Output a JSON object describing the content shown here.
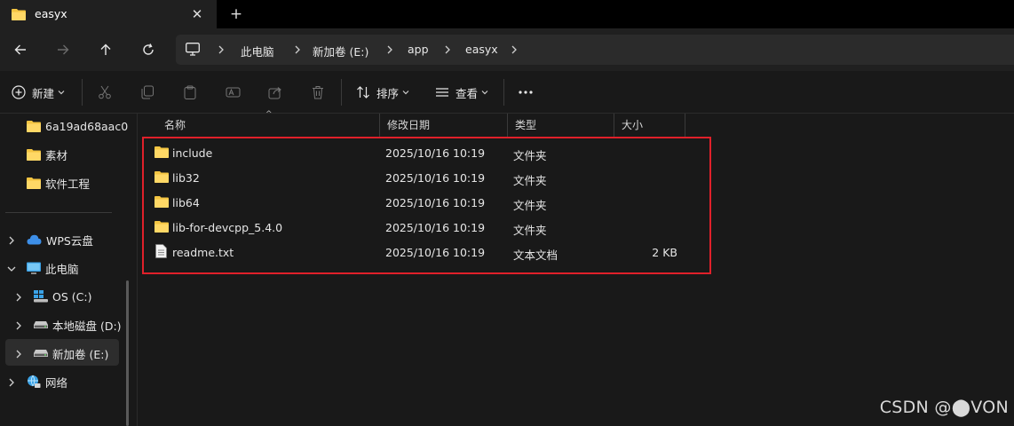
{
  "tab": {
    "title": "easyx"
  },
  "breadcrumb": [
    "此电脑",
    "新加卷 (E:)",
    "app",
    "easyx"
  ],
  "commands": {
    "new_label": "新建",
    "sort_label": "排序",
    "view_label": "查看"
  },
  "sidebar": {
    "quick": [
      {
        "label": "6a19ad68aac0"
      },
      {
        "label": "素材"
      },
      {
        "label": "软件工程"
      }
    ],
    "tree": [
      {
        "label": "WPS云盘"
      },
      {
        "label": "此电脑"
      },
      {
        "label": "OS (C:)"
      },
      {
        "label": "本地磁盘 (D:)"
      },
      {
        "label": "新加卷 (E:)"
      },
      {
        "label": "网络"
      }
    ]
  },
  "columns": {
    "name": "名称",
    "modified": "修改日期",
    "type": "类型",
    "size": "大小"
  },
  "files": [
    {
      "name": "include",
      "modified": "2025/10/16 10:19",
      "type": "文件夹",
      "size": "",
      "icon": "folder-icon"
    },
    {
      "name": "lib32",
      "modified": "2025/10/16 10:19",
      "type": "文件夹",
      "size": "",
      "icon": "folder-icon"
    },
    {
      "name": "lib64",
      "modified": "2025/10/16 10:19",
      "type": "文件夹",
      "size": "",
      "icon": "folder-icon"
    },
    {
      "name": "lib-for-devcpp_5.4.0",
      "modified": "2025/10/16 10:19",
      "type": "文件夹",
      "size": "",
      "icon": "folder-icon"
    },
    {
      "name": "readme.txt",
      "modified": "2025/10/16 10:19",
      "type": "文本文档",
      "size": "2 KB",
      "icon": "text-file-icon"
    }
  ],
  "watermark": "CSDN @⬤VON",
  "colors": {
    "folder": "#f4c542",
    "highlight": "#e0202a",
    "background": "#191919"
  }
}
